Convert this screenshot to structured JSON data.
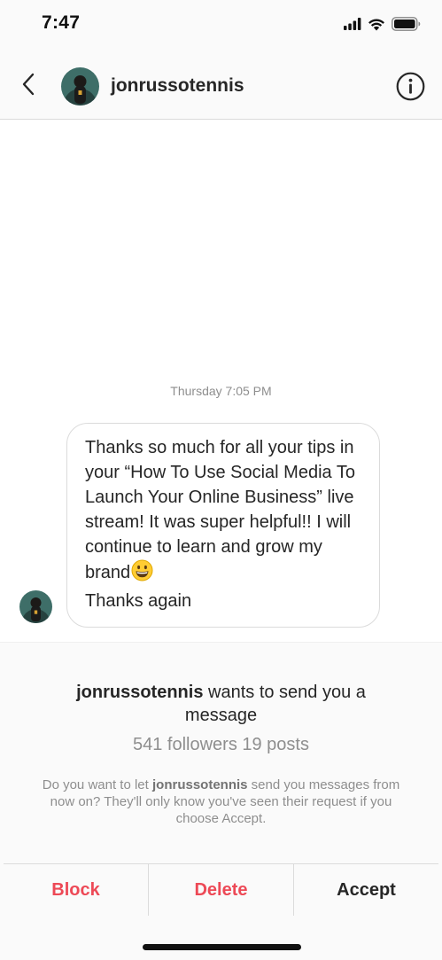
{
  "status_bar": {
    "time": "7:47",
    "icons": [
      "signal-icon",
      "wifi-icon",
      "battery-icon"
    ]
  },
  "header": {
    "back_icon": "chevron-left-icon",
    "username": "jonrussotennis",
    "info_icon": "info-icon"
  },
  "conversation": {
    "timestamp": "Thursday 7:05 PM",
    "message": {
      "text_before_emoji": "Thanks so much for all your tips in your “How To Use Social Media To Launch Your Online Business” live stream! It was super helpful!! I will continue to learn and grow my brand",
      "emoji": "grinning-face-emoji",
      "text_after_emoji": "Thanks again"
    }
  },
  "request": {
    "username": "jonrussotennis",
    "title_suffix": " wants to send you a message",
    "stats": "541 followers 19 posts",
    "desc_prefix": "Do you want to let ",
    "desc_username": "jonrussotennis",
    "desc_suffix": " send you messages from now on? They'll only know you've seen their request if you choose Accept."
  },
  "actions": {
    "block_label": "Block",
    "delete_label": "Delete",
    "accept_label": "Accept"
  },
  "colors": {
    "danger": "#ed4956",
    "text": "#262626",
    "muted": "#8e8e8e",
    "border": "#dbdbdb"
  }
}
